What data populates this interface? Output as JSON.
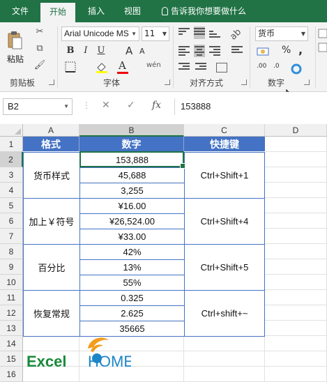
{
  "tabs": [
    {
      "label": "文件",
      "active": false
    },
    {
      "label": "开始",
      "active": true
    },
    {
      "label": "插入",
      "active": false
    },
    {
      "label": "视图",
      "active": false
    }
  ],
  "tell_me": "告诉我你想要做什么",
  "ribbon": {
    "clipboard": {
      "paste_label": "粘贴",
      "group_label": "剪贴板"
    },
    "font": {
      "font_name": "Arial Unicode MS",
      "font_size": "11",
      "group_label": "字体",
      "bold": "B",
      "italic": "I",
      "underline": "U",
      "grow": "A",
      "shrink": "A"
    },
    "alignment": {
      "group_label": "对齐方式"
    },
    "number": {
      "format": "货币",
      "group_label": "数字",
      "percent": "%",
      "comma": ",",
      "inc_decimal": ".00",
      "dec_decimal": ".0"
    }
  },
  "formula_bar": {
    "name_box": "B2",
    "formula": "153888",
    "fx": "fx"
  },
  "columns": [
    "A",
    "B",
    "C",
    "D"
  ],
  "rows": [
    "1",
    "2",
    "3",
    "4",
    "5",
    "6",
    "7",
    "8",
    "9",
    "10",
    "11",
    "12",
    "13",
    "14",
    "15",
    "16"
  ],
  "table": {
    "headers": {
      "format": "格式",
      "number": "数字",
      "shortcut": "快捷键"
    },
    "groups": [
      {
        "format": "货币样式",
        "shortcut": "Ctrl+Shift+1",
        "values": [
          "153,888",
          "45,688",
          "3,255"
        ]
      },
      {
        "format": "加上￥符号",
        "shortcut": "Ctrl+Shift+4",
        "values": [
          "¥16.00",
          "¥26,524.00",
          "¥33.00"
        ]
      },
      {
        "format": "百分比",
        "shortcut": "Ctrl+Shift+5",
        "values": [
          "42%",
          "13%",
          "55%"
        ]
      },
      {
        "format": "恢复常规",
        "shortcut": "Ctrl+shift+~",
        "values": [
          "0.325",
          "2.625",
          "35665"
        ]
      }
    ]
  },
  "logo": {
    "text_excel": "Excel",
    "text_home": "HOME"
  },
  "colors": {
    "excel_green": "#217346",
    "header_blue": "#4472c4",
    "logo_orange": "#f39c1f"
  }
}
